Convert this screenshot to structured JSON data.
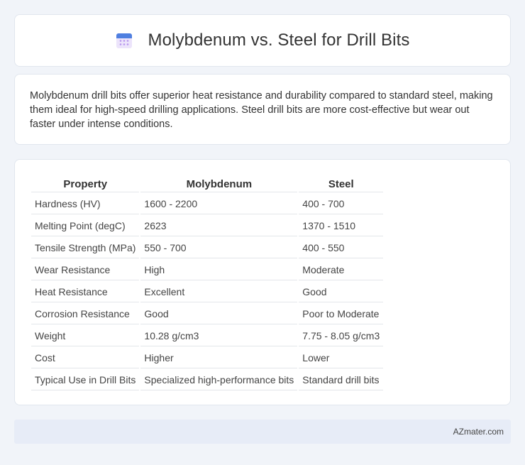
{
  "header": {
    "title": "Molybdenum vs. Steel for Drill Bits",
    "icon": "calendar-icon"
  },
  "description": "Molybdenum drill bits offer superior heat resistance and durability compared to standard steel, making them ideal for high-speed drilling applications. Steel drill bits are more cost-effective but wear out faster under intense conditions.",
  "table": {
    "headers": [
      "Property",
      "Molybdenum",
      "Steel"
    ],
    "rows": [
      [
        "Hardness (HV)",
        "1600 - 2200",
        "400 - 700"
      ],
      [
        "Melting Point (degC)",
        "2623",
        "1370 - 1510"
      ],
      [
        "Tensile Strength (MPa)",
        "550 - 700",
        "400 - 550"
      ],
      [
        "Wear Resistance",
        "High",
        "Moderate"
      ],
      [
        "Heat Resistance",
        "Excellent",
        "Good"
      ],
      [
        "Corrosion Resistance",
        "Good",
        "Poor to Moderate"
      ],
      [
        "Weight",
        "10.28 g/cm3",
        "7.75 - 8.05 g/cm3"
      ],
      [
        "Cost",
        "Higher",
        "Lower"
      ],
      [
        "Typical Use in Drill Bits",
        "Specialized high-performance bits",
        "Standard drill bits"
      ]
    ]
  },
  "footer": {
    "text": "AZmater.com"
  },
  "colors": {
    "background": "#f1f4f9",
    "card": "#ffffff",
    "footer_bg": "#e7ecf7",
    "icon_accent": "#4f7fe0",
    "icon_body": "#ece4fb",
    "icon_dots": "#b895ee"
  }
}
